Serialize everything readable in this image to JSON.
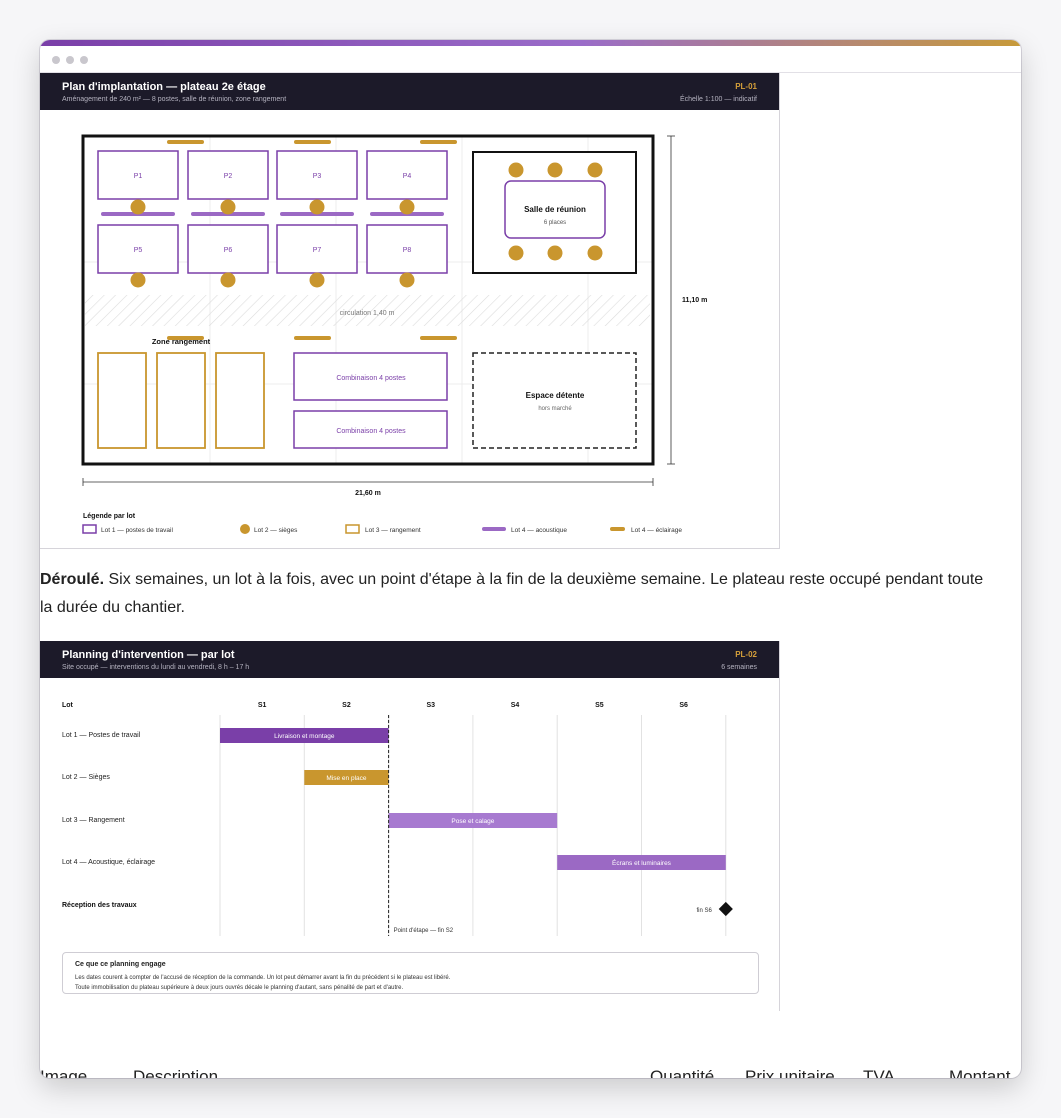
{
  "window": {
    "dots": [
      "close",
      "minimize",
      "maximize"
    ]
  },
  "colors": {
    "purple": "#7a3fa8",
    "purple_light": "#a77ad0",
    "gold": "#c9962e",
    "dark": "#1c1a29",
    "header_accent": "#d5a03a"
  },
  "plan": {
    "title": "Plan d'implantation — plateau 2e étage",
    "subtitle": "Aménagement de 240 m² — 8 postes, salle de réunion, zone rangement",
    "code": "PL-01",
    "scale": "Échelle 1:100 — indicatif",
    "posts": [
      "P1",
      "P2",
      "P3",
      "P4",
      "P5",
      "P6",
      "P7",
      "P8"
    ],
    "meeting": {
      "title": "Salle de réunion",
      "sub": "6 places"
    },
    "circulation": "circulation 1,40 m",
    "storage_label": "Zone rangement",
    "combo": [
      "Combinaison 4 postes",
      "Combinaison 4 postes"
    ],
    "relax": {
      "title": "Espace détente",
      "sub": "hors marché"
    },
    "dim_h": "11,10 m",
    "dim_w": "21,60 m",
    "legend_title": "Légende par lot",
    "legend": [
      "Lot 1 — postes de travail",
      "Lot 2 — sièges",
      "Lot 3 — rangement",
      "Lot 4 — acoustique",
      "Lot 4 — éclairage"
    ]
  },
  "paragraph": {
    "lead": "Déroulé.",
    "text": " Six semaines, un lot à la fois, avec un point d'étape à la fin de la deuxième semaine. Le plateau reste occupé pendant toute la durée du chantier."
  },
  "planning": {
    "title": "Planning d'intervention — par lot",
    "subtitle": "Site occupé — interventions du lundi au vendredi, 8 h – 17 h",
    "code": "PL-02",
    "duration": "6 semaines",
    "col_lot": "Lot",
    "weeks": [
      "S1",
      "S2",
      "S3",
      "S4",
      "S5",
      "S6"
    ],
    "rows": [
      {
        "label": "Lot 1 — Postes de travail",
        "task": "Livraison et montage",
        "start": 0,
        "end": 2,
        "color": "#7a3fa8"
      },
      {
        "label": "Lot 2 — Sièges",
        "task": "Mise en place",
        "start": 1,
        "end": 2,
        "color": "#c9962e"
      },
      {
        "label": "Lot 3 — Rangement",
        "task": "Pose et calage",
        "start": 2,
        "end": 4,
        "color": "#a77ad0"
      },
      {
        "label": "Lot 4 — Acoustique, éclairage",
        "task": "Écrans et luminaires",
        "start": 4,
        "end": 6,
        "color": "#9b69c4"
      }
    ],
    "reception": {
      "label": "Réception des travaux",
      "marker": "fin S6",
      "at": 6
    },
    "milestone": {
      "label": "Point d'étape — fin S2",
      "at": 2
    },
    "note": {
      "title": "Ce que ce planning engage",
      "line1": "Les dates courent à compter de l'accusé de réception de la commande. Un lot peut démarrer avant la fin du précédent si le plateau est libéré.",
      "line2": "Toute immobilisation du plateau supérieure à deux jours ouvrés décale le planning d'autant, sans pénalité de part et d'autre."
    }
  },
  "table_header": [
    "Image",
    "Description",
    "Quantité",
    "Prix unitaire",
    "TVA",
    "Montant"
  ]
}
